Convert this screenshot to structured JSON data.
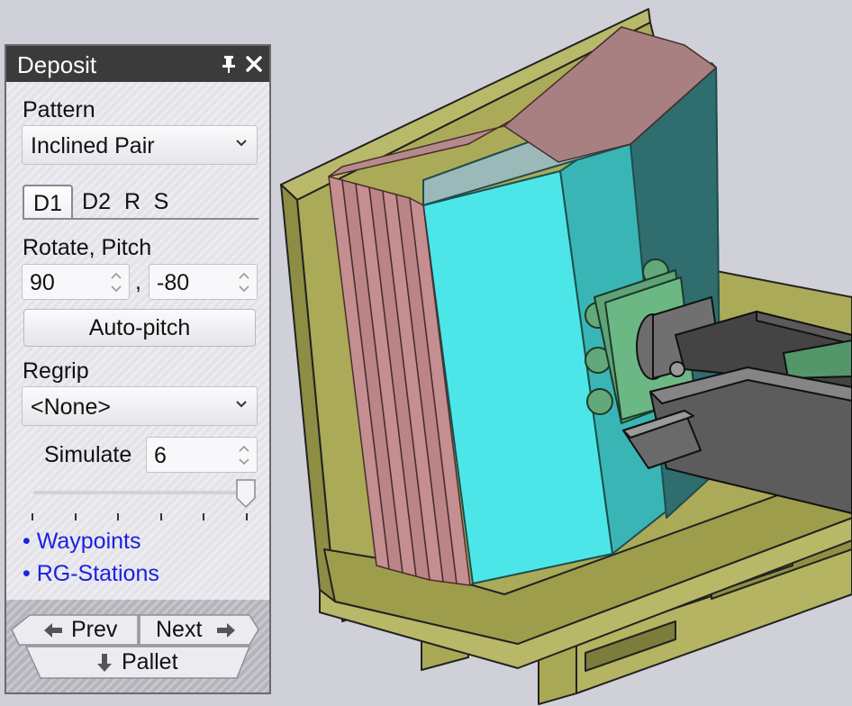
{
  "panel": {
    "title": "Deposit",
    "pattern_label": "Pattern",
    "pattern_value": "Inclined Pair",
    "tabs": [
      {
        "label": "D1",
        "active": true
      },
      {
        "label": "D2",
        "active": false
      },
      {
        "label": "R",
        "active": false
      },
      {
        "label": "S",
        "active": false
      }
    ],
    "rotate_pitch_label": "Rotate, Pitch",
    "rotate_value": "90",
    "separator": ",",
    "pitch_value": "-80",
    "auto_pitch_label": "Auto-pitch",
    "regrip_label": "Regrip",
    "regrip_value": "<None>",
    "simulate_label": "Simulate",
    "simulate_value": "6",
    "slider_level": 1.0,
    "slider_tick_count": 6,
    "links": [
      "• Waypoints",
      "• RG-Stations"
    ],
    "link_color": "#1a22e0"
  },
  "nav": {
    "prev_label": "Prev",
    "next_label": "Next",
    "pallet_label": "Pallet"
  },
  "colors": {
    "viewport_bg": "#cfd0d8",
    "title_bar": "#3b3b3b",
    "box_cyan": "#4de3e6",
    "box_teal": "#3fb8b8",
    "pallet_olive": "#a9a95a",
    "plate_pink": "#c48d8f",
    "gripper_green": "#63a87a",
    "robot_gray": "#5d5d5d"
  },
  "icons": [
    "pin-icon",
    "close-icon",
    "chevron-down-icon",
    "arrow-left-icon",
    "arrow-right-icon",
    "arrow-down-icon"
  ]
}
